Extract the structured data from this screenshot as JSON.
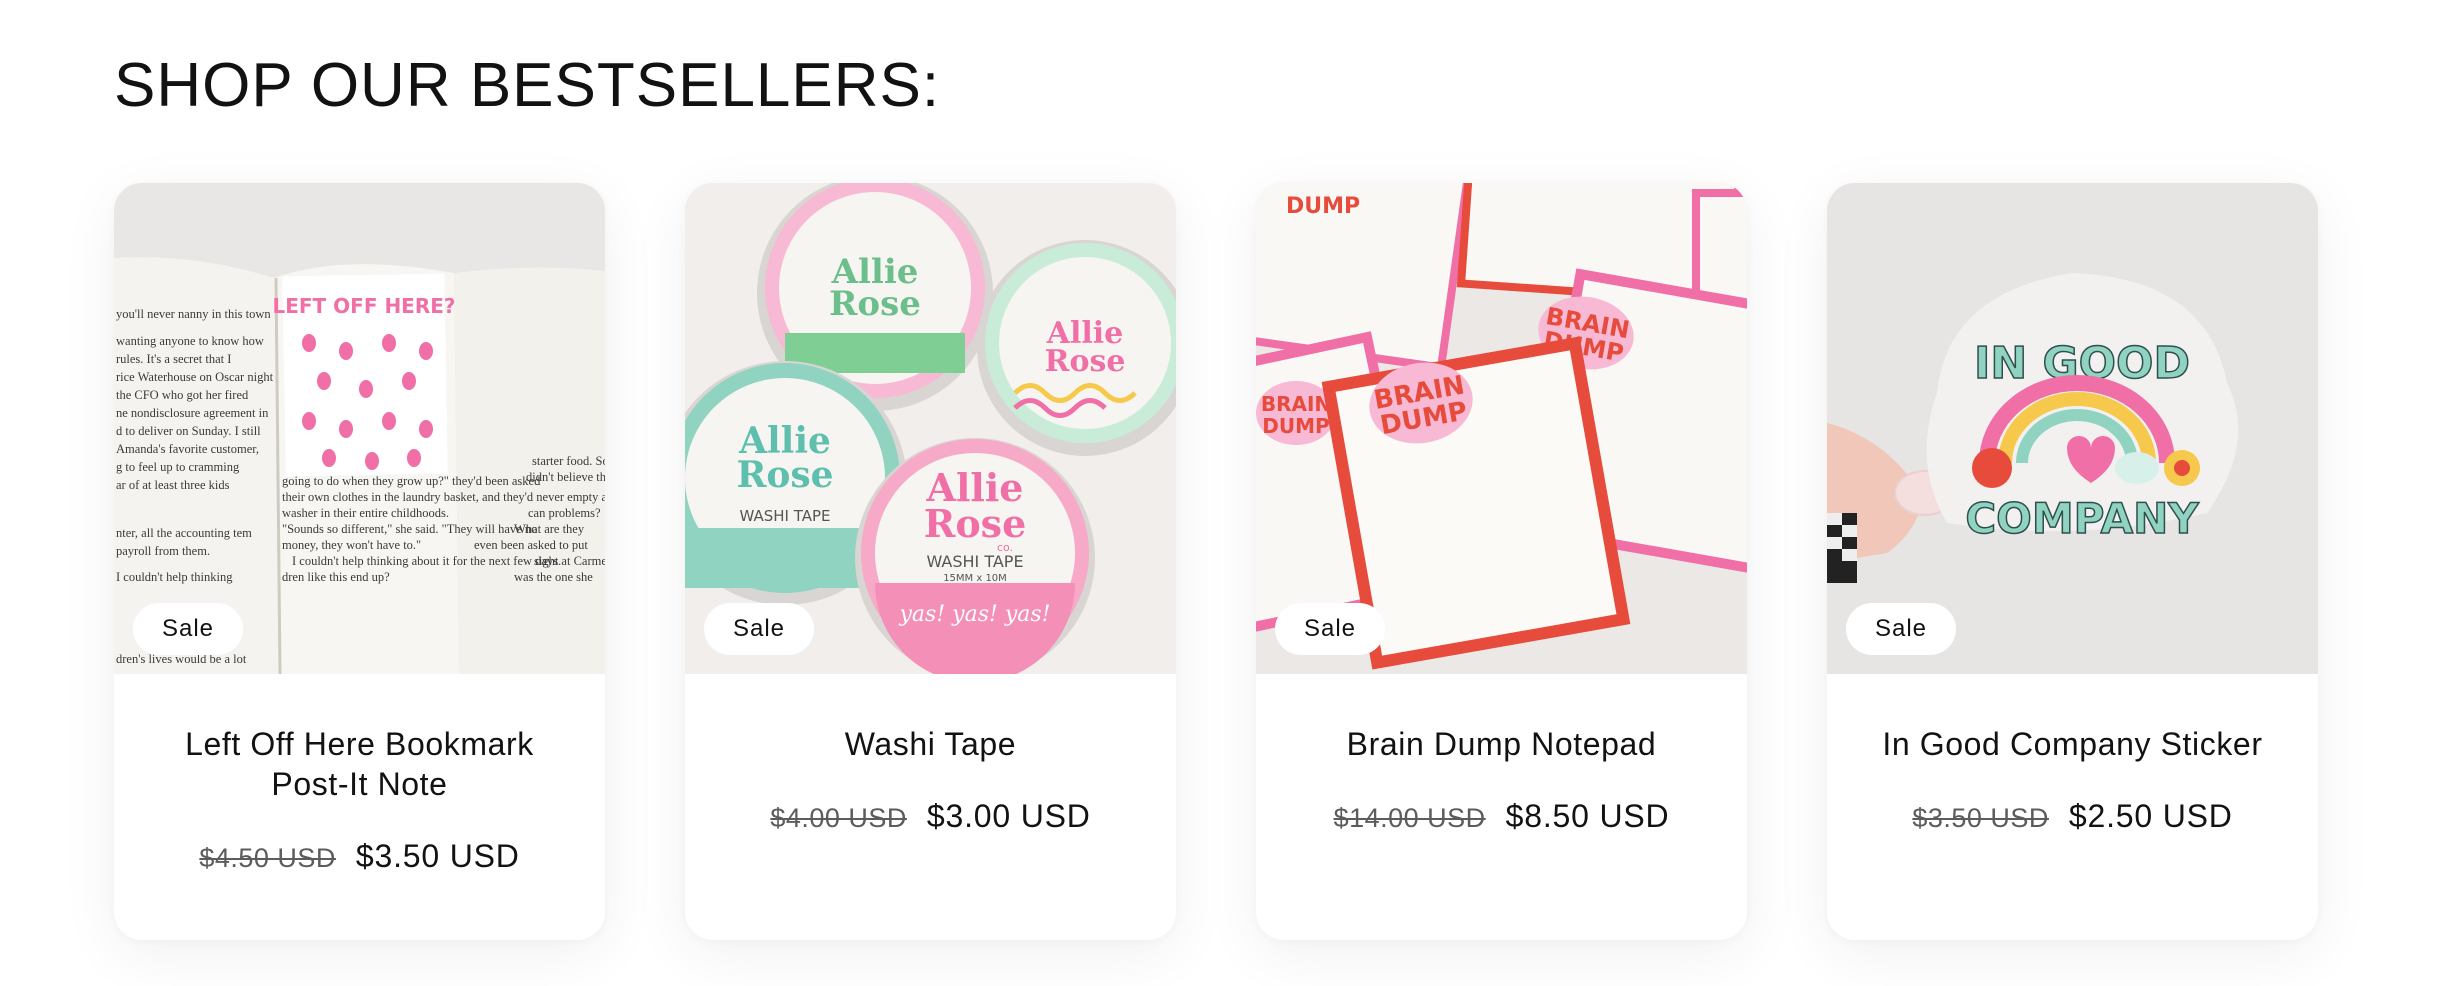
{
  "section": {
    "heading": "SHOP OUR BESTSELLERS:"
  },
  "products": [
    {
      "title": "Left Off Here Bookmark Post-It Note",
      "badge": "Sale",
      "compare_price": "$4.50 USD",
      "price": "$3.50 USD",
      "image": {
        "note_text": "LEFT OFF HERE?",
        "page_text_left": [
          "you'll never nanny in this town",
          "wanting anyone to know how",
          "rules. It's a secret that I",
          "rice Waterhouse on Oscar night",
          "the CFO who got her fired",
          "ne nondisclosure agreement in",
          "d to deliver on Sunday. I still",
          "Amanda's favorite customer,",
          "g to feel up to cramming",
          "ar of at least three kids",
          "nter, all the accounting tem",
          "payroll from them.",
          "I couldn't help thinking",
          "dren's lives would be a lot"
        ],
        "page_text_right": [
          "starter food. Some",
          "didn't believe the",
          "can problems?",
          "What are they",
          "even been asked to put",
          "sight at Carmen",
          "was the one she",
          "going to do when they grow up?\" they'd been asked",
          "their own clothes in the laundry basket, and they'd never empty a",
          "washer in their entire childhoods.",
          "\"Sounds so different,\" she said. \"They will have no",
          "money, they won't have to.\"",
          "I couldn't help thinking about it for the next few days.",
          "dren like this end up?"
        ]
      }
    },
    {
      "title": "Washi Tape",
      "badge": "Sale",
      "compare_price": "$4.00 USD",
      "price": "$3.00 USD",
      "image": {
        "brand_line1": "Allie",
        "brand_line2": "Rose",
        "brand_sub": "co.",
        "product_line": "WASHI TAPE",
        "size_line": "15MM x 10M",
        "script_text": "yas! yas! yas!"
      }
    },
    {
      "title": "Brain Dump Notepad",
      "badge": "Sale",
      "compare_price": "$14.00 USD",
      "price": "$8.50 USD",
      "image": {
        "cloud_line1": "BRAIN",
        "cloud_line2": "DUMP"
      }
    },
    {
      "title": "In Good Company Sticker",
      "badge": "Sale",
      "compare_price": "$3.50 USD",
      "price": "$2.50 USD",
      "image": {
        "top_text": "IN GOOD",
        "bottom_text": "COMPANY"
      }
    }
  ],
  "colors": {
    "pink": "#ef6fa6",
    "light_pink": "#f7b9d3",
    "red": "#e64b3c",
    "mint": "#8fd3c0",
    "green": "#6cbf8a",
    "yellow": "#f6c84c"
  }
}
